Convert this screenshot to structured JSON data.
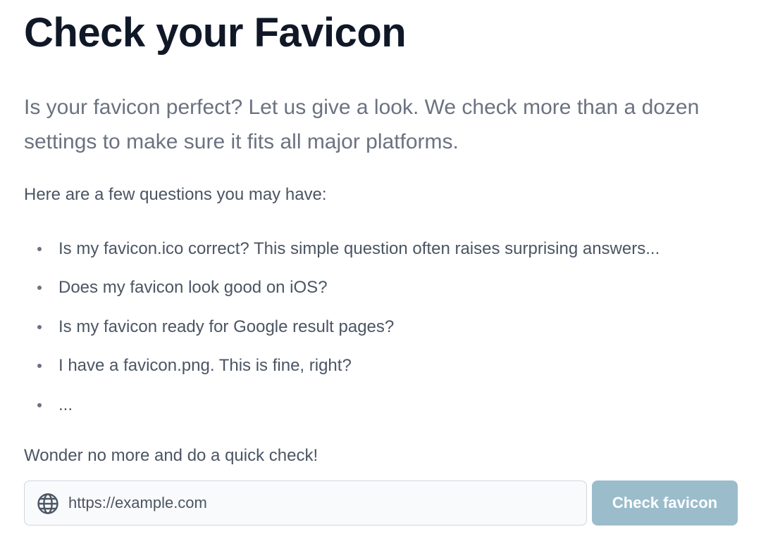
{
  "page": {
    "title": "Check your Favicon",
    "lead": "Is your favicon perfect? Let us give a look. We check more than a dozen settings to make sure it fits all major platforms.",
    "intro": "Here are a few questions you may have:",
    "questions": [
      "Is my favicon.ico correct? This simple question often raises surprising answers...",
      "Does my favicon look good on iOS?",
      "Is my favicon ready for Google result pages?",
      "I have a favicon.png. This is fine, right?",
      "..."
    ],
    "outro": "Wonder no more and do a quick check!"
  },
  "form": {
    "url_placeholder": "https://example.com",
    "url_value": "",
    "url_icon": "globe-icon",
    "submit_label": "Check favicon",
    "submit_color": "#9bbccb"
  }
}
